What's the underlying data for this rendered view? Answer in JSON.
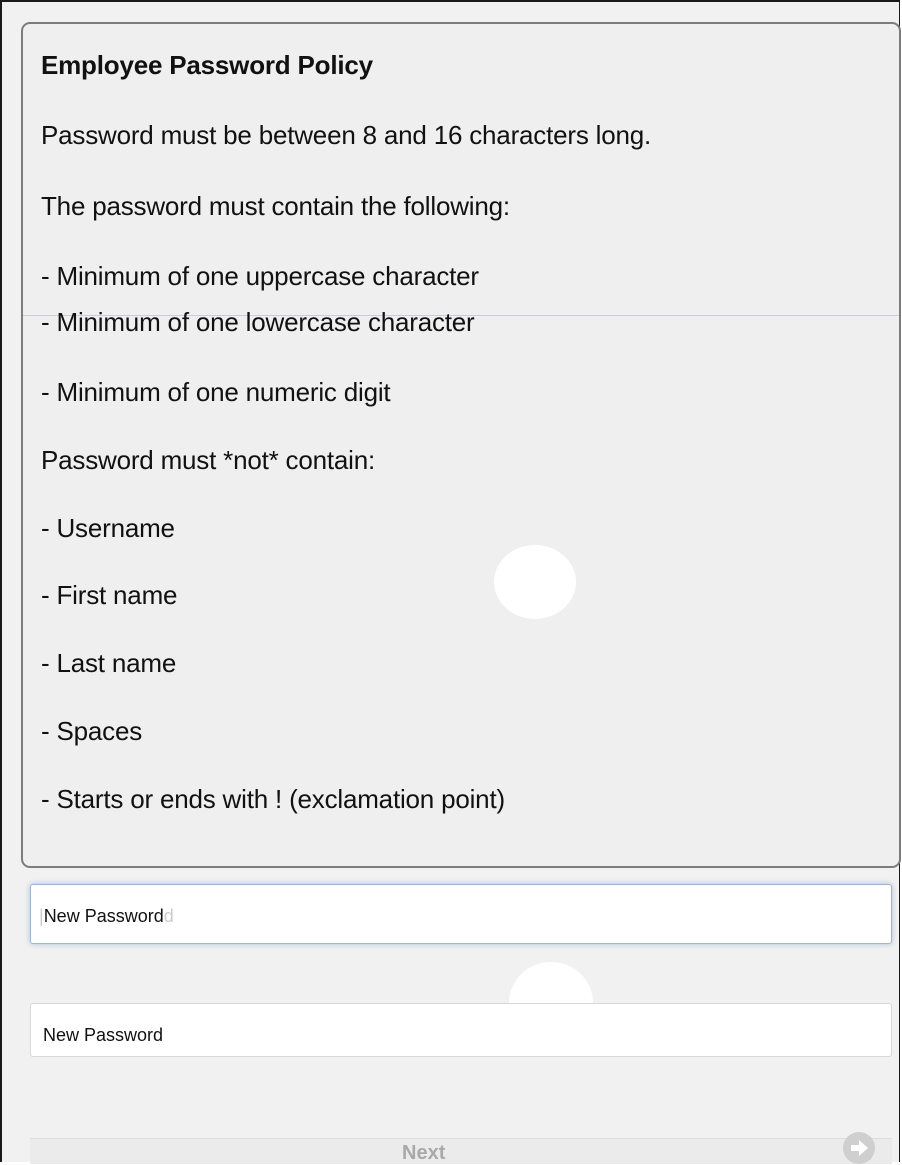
{
  "policy": {
    "title": "Employee Password Policy",
    "length_rule": "Password must be between 8 and 16 characters long.",
    "contain_heading": "The password must contain the following:",
    "contain_rules": [
      "- Minimum of one uppercase character",
      "- Minimum of one lowercase character",
      "- Minimum of one numeric digit"
    ],
    "not_contain_heading": "Password must *not* contain:",
    "not_contain_rules": [
      "- Username",
      "- First name",
      "- Last name",
      "- Spaces",
      "- Starts or ends with ! (exclamation point)"
    ]
  },
  "form": {
    "new_password_placeholder": "New Password",
    "confirm_password_placeholder": "New Password",
    "next_label": "Next",
    "next_icon": "arrow-right-circle-icon"
  }
}
